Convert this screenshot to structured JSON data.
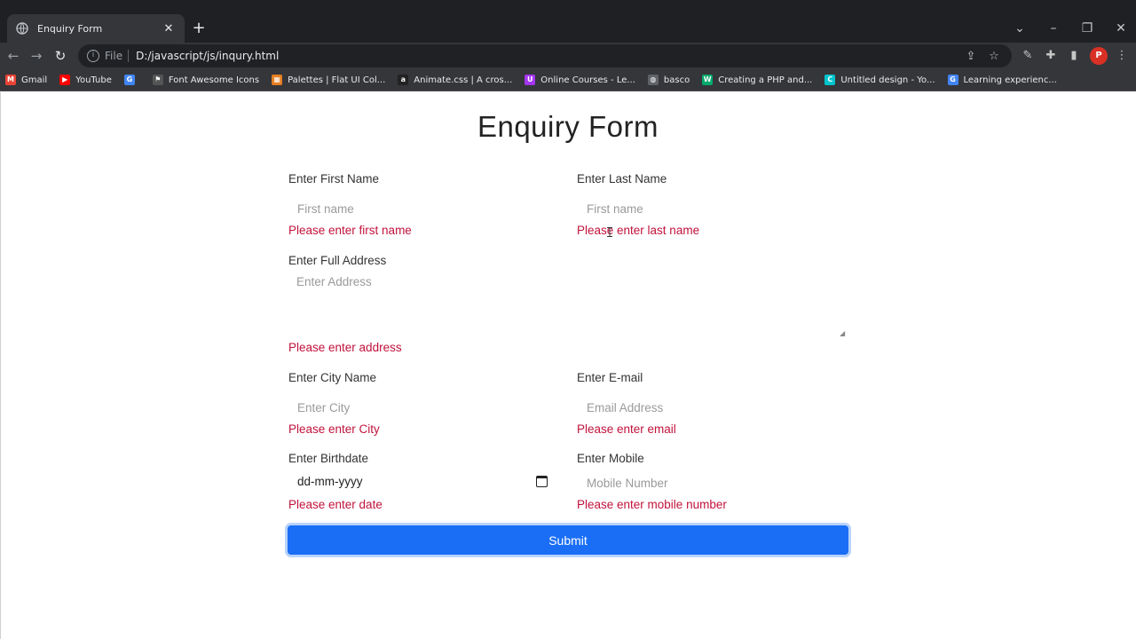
{
  "browser": {
    "tab_title": "Enquiry Form",
    "tab_close": "✕",
    "new_tab": "+",
    "scheme": "File",
    "url": "D:/javascript/js/inqury.html",
    "profile_initial": "P"
  },
  "bookmarks": [
    {
      "label": "Gmail",
      "icon": "gmail-icon",
      "color": "#ea4335",
      "glyph": "M"
    },
    {
      "label": "YouTube",
      "icon": "youtube-icon",
      "color": "#ff0000",
      "glyph": "▶"
    },
    {
      "label": "",
      "icon": "google-icon",
      "color": "#4285f4",
      "glyph": "G"
    },
    {
      "label": "Font Awesome Icons",
      "icon": "flag-icon",
      "color": "#555555",
      "glyph": "⚑"
    },
    {
      "label": "Palettes | Flat UI Col...",
      "icon": "palette-icon",
      "color": "#e67e22",
      "glyph": "▦"
    },
    {
      "label": "Animate.css | A cros...",
      "icon": "animate-icon",
      "color": "#222222",
      "glyph": "a"
    },
    {
      "label": "Online Courses - Le...",
      "icon": "udemy-icon",
      "color": "#a435f0",
      "glyph": "U"
    },
    {
      "label": "basco",
      "icon": "globe-icon",
      "color": "#5f6368",
      "glyph": "◍"
    },
    {
      "label": "Creating a PHP and...",
      "icon": "w3-icon",
      "color": "#04aa6d",
      "glyph": "W"
    },
    {
      "label": "Untitled design - Yo...",
      "icon": "canva-icon",
      "color": "#00c4cc",
      "glyph": "C"
    },
    {
      "label": "Learning experienc...",
      "icon": "google-icon",
      "color": "#4285f4",
      "glyph": "G"
    }
  ],
  "form": {
    "title": "Enquiry Form",
    "first_name": {
      "label": "Enter First Name",
      "placeholder": "First name",
      "error": "Please enter first name"
    },
    "last_name": {
      "label": "Enter Last Name",
      "placeholder": "First name",
      "error": "Please enter last name"
    },
    "address": {
      "label": "Enter Full Address",
      "placeholder": "Enter Address",
      "error": "Please enter address"
    },
    "city": {
      "label": "Enter City Name",
      "placeholder": "Enter City",
      "error": "Please enter City"
    },
    "email": {
      "label": "Enter E-mail",
      "placeholder": "Email Address",
      "error": "Please enter email"
    },
    "birthdate": {
      "label": "Enter Birthdate",
      "value": "dd-mm-yyyy",
      "error": "Please enter date"
    },
    "mobile": {
      "label": "Enter Mobile",
      "placeholder": "Mobile Number",
      "error": "Please enter mobile number"
    },
    "submit_label": "Submit"
  },
  "colors": {
    "error": "#c1123b",
    "submit": "#1a6ef5",
    "chrome_dark": "#1f2023",
    "chrome_toolbar": "#35363a"
  }
}
